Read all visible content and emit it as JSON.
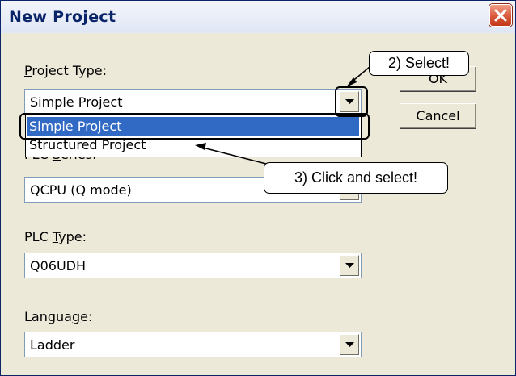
{
  "dialog": {
    "title": "New Project",
    "close_icon": "close-icon",
    "project_type": {
      "label_mnemonic": "P",
      "label_rest": "roject Type:",
      "value": "Simple Project",
      "options": [
        "Simple Project",
        "Structured Project"
      ],
      "selected_index": 0
    },
    "plc_series": {
      "label_prefix": "PLC ",
      "label_mnemonic": "S",
      "label_rest": "eries:",
      "value": "QCPU (Q mode)"
    },
    "plc_type": {
      "label_prefix": "PLC ",
      "label_mnemonic": "T",
      "label_rest": "ype:",
      "value": "Q06UDH"
    },
    "language": {
      "label_prefix": "Langua",
      "label_mnemonic": "g",
      "label_rest": "e:",
      "value": "Ladder"
    },
    "ok_label": "OK",
    "cancel_label": "Cancel"
  },
  "annotations": {
    "step2": "2) Select!",
    "step3": "3) Click and select!"
  },
  "colors": {
    "dialog_bg": "#ece9d8",
    "title_text": "#0a246a",
    "selection": "#316ac5",
    "close_button": "#d9583a"
  }
}
